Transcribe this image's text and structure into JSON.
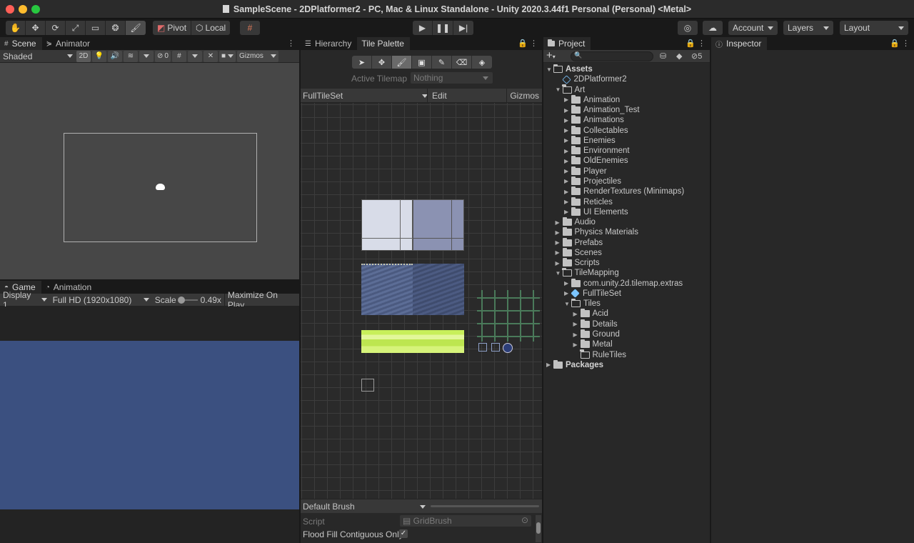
{
  "window": {
    "title": "SampleScene - 2DPlatformer2 - PC, Mac & Linux Standalone - Unity 2020.3.44f1 Personal (Personal) <Metal>"
  },
  "toolbar": {
    "pivot": "Pivot",
    "local": "Local",
    "account": "Account",
    "layers": "Layers",
    "layout": "Layout"
  },
  "scene_panel": {
    "tabs": [
      "Scene",
      "Animator"
    ],
    "shading": "Shaded",
    "mode_2d": "2D",
    "hidden_count": "0",
    "gizmos": "Gizmos"
  },
  "game_panel": {
    "tabs": [
      "Game",
      "Animation"
    ],
    "display": "Display 1",
    "resolution": "Full HD (1920x1080)",
    "scale_label": "Scale",
    "scale_value": "0.49x",
    "maximize": "Maximize On Play"
  },
  "palette_panel": {
    "tabs": [
      "Hierarchy",
      "Tile Palette"
    ],
    "active_tilemap_label": "Active Tilemap",
    "active_tilemap_value": "Nothing",
    "palette_name": "FullTileSet",
    "edit": "Edit",
    "gizmos": "Gizmos",
    "brush": "Default Brush",
    "script_label": "Script",
    "script_value": "GridBrush",
    "flood_fill": "Flood Fill Contiguous Only"
  },
  "project_panel": {
    "tab": "Project",
    "hidden_count": "5",
    "tree": [
      {
        "label": "Assets",
        "depth": 0,
        "type": "folder-open",
        "arrow": "open",
        "bold": true
      },
      {
        "label": "2DPlatformer2",
        "depth": 1,
        "type": "scene",
        "arrow": "none"
      },
      {
        "label": "Art",
        "depth": 1,
        "type": "folder-open",
        "arrow": "open"
      },
      {
        "label": "Animation",
        "depth": 2,
        "type": "folder",
        "arrow": "closed"
      },
      {
        "label": "Animation_Test",
        "depth": 2,
        "type": "folder",
        "arrow": "closed"
      },
      {
        "label": "Animations",
        "depth": 2,
        "type": "folder",
        "arrow": "closed"
      },
      {
        "label": "Collectables",
        "depth": 2,
        "type": "folder",
        "arrow": "closed"
      },
      {
        "label": "Enemies",
        "depth": 2,
        "type": "folder",
        "arrow": "closed"
      },
      {
        "label": "Environment",
        "depth": 2,
        "type": "folder",
        "arrow": "closed"
      },
      {
        "label": "OldEnemies",
        "depth": 2,
        "type": "folder",
        "arrow": "closed"
      },
      {
        "label": "Player",
        "depth": 2,
        "type": "folder",
        "arrow": "closed"
      },
      {
        "label": "Projectiles",
        "depth": 2,
        "type": "folder",
        "arrow": "closed"
      },
      {
        "label": "RenderTextures (Minimaps)",
        "depth": 2,
        "type": "folder",
        "arrow": "closed"
      },
      {
        "label": "Reticles",
        "depth": 2,
        "type": "folder",
        "arrow": "closed"
      },
      {
        "label": "UI Elements",
        "depth": 2,
        "type": "folder",
        "arrow": "closed"
      },
      {
        "label": "Audio",
        "depth": 1,
        "type": "folder",
        "arrow": "closed"
      },
      {
        "label": "Physics Materials",
        "depth": 1,
        "type": "folder",
        "arrow": "closed"
      },
      {
        "label": "Prefabs",
        "depth": 1,
        "type": "folder",
        "arrow": "closed"
      },
      {
        "label": "Scenes",
        "depth": 1,
        "type": "folder",
        "arrow": "closed"
      },
      {
        "label": "Scripts",
        "depth": 1,
        "type": "folder",
        "arrow": "closed"
      },
      {
        "label": "TileMapping",
        "depth": 1,
        "type": "folder-open",
        "arrow": "open"
      },
      {
        "label": "com.unity.2d.tilemap.extras",
        "depth": 2,
        "type": "folder",
        "arrow": "closed"
      },
      {
        "label": "FullTileSet",
        "depth": 2,
        "type": "prefab",
        "arrow": "closed"
      },
      {
        "label": "Tiles",
        "depth": 2,
        "type": "folder-open",
        "arrow": "open"
      },
      {
        "label": "Acid",
        "depth": 3,
        "type": "folder",
        "arrow": "closed"
      },
      {
        "label": "Details",
        "depth": 3,
        "type": "folder",
        "arrow": "closed"
      },
      {
        "label": "Ground",
        "depth": 3,
        "type": "folder",
        "arrow": "closed"
      },
      {
        "label": "Metal",
        "depth": 3,
        "type": "folder",
        "arrow": "closed"
      },
      {
        "label": "RuleTiles",
        "depth": 3,
        "type": "folder-empty",
        "arrow": "none"
      },
      {
        "label": "Packages",
        "depth": 0,
        "type": "folder",
        "arrow": "closed",
        "bold": true
      }
    ]
  },
  "inspector_panel": {
    "tab": "Inspector"
  },
  "colors": {
    "game_background": "#3b5080",
    "scene_background": "#474747",
    "acid_tile": "#c8ef5a"
  }
}
